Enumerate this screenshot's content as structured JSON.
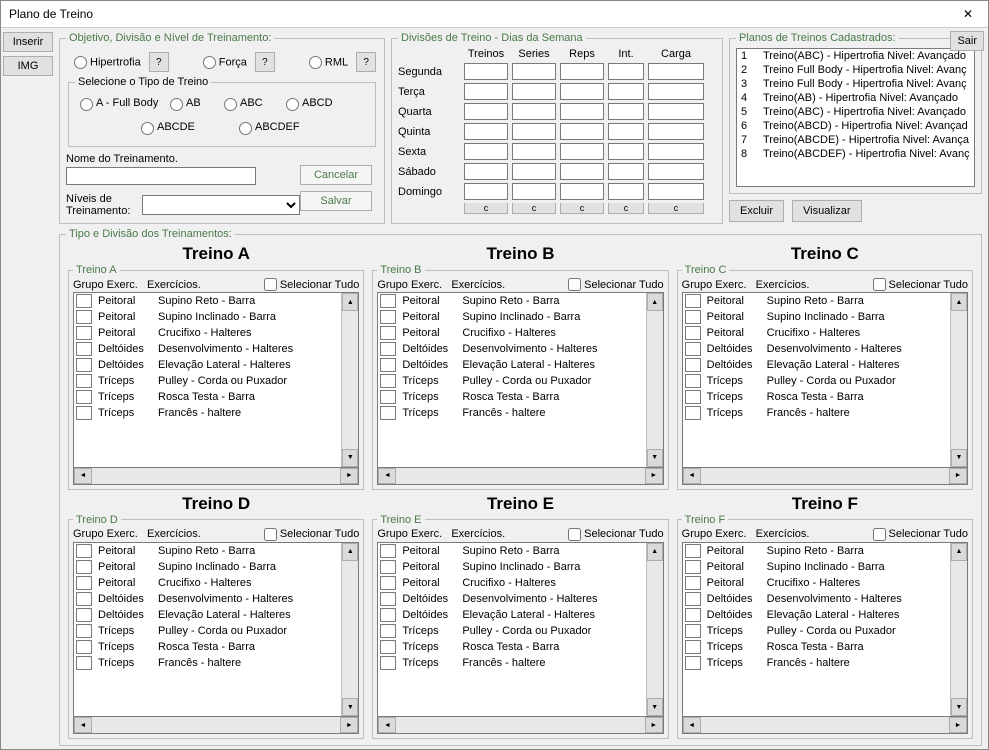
{
  "window_title": "Plano de Treino",
  "btn_inserir": "Inserir",
  "btn_img": "IMG",
  "btn_sair": "Sair",
  "obj": {
    "legend": "Objetivo, Divisão e Nível de Treinamento:",
    "hipertrofia": "Hipertrofia",
    "forca": "Força",
    "rml": "RML",
    "q": "?",
    "tipo_legend": "Selecione o Tipo de Treino",
    "tipo": {
      "a": "A - Full Body",
      "ab": "AB",
      "abc": "ABC",
      "abcd": "ABCD",
      "abcde": "ABCDE",
      "abcdef": "ABCDEF"
    },
    "nome_lbl": "Nome do Treinamento.",
    "nome_val": "",
    "niv_lbl": "Níveis de Treinamento:",
    "cancelar": "Cancelar",
    "salvar": "Salvar"
  },
  "div": {
    "legend": "Divisões de Treino - Dias da Semana",
    "cols": [
      "Treinos",
      "Series",
      "Reps",
      "Int.",
      "Carga"
    ],
    "days": [
      "Segunda",
      "Terça",
      "Quarta",
      "Quinta",
      "Sexta",
      "Sábado",
      "Domingo"
    ],
    "c": "c"
  },
  "planos": {
    "legend": "Planos de Treinos Cadastrados:",
    "items": [
      "Treino(ABC) - Hipertrofia Nivel: Avançado",
      "Treino Full Body - Hipertrofia Nivel: Avanç",
      "Treino Full Body - Hipertrofia Nivel: Avanç",
      "Treino(AB) - Hipertrofia Nivel: Avançado",
      "Treino(ABC) - Hipertrofia Nivel: Avançado",
      "Treino(ABCD) - Hipertrofia Nivel: Avançad",
      "Treino(ABCDE) - Hipertrofia Nivel: Avança",
      "Treino(ABCDEF) - Hipertrofia Nivel: Avanç"
    ],
    "excluir": "Excluir",
    "visualizar": "Visualizar"
  },
  "big": {
    "legend": "Tipo e Divisão dos Treinamentos:",
    "titles": [
      "Treino A",
      "Treino B",
      "Treino C",
      "Treino D",
      "Treino E",
      "Treino F"
    ],
    "fset_legends": [
      "Treino A",
      "Treino B",
      "Treino C",
      "Treino D",
      "Treino E",
      "Treino F"
    ],
    "hdr_g": "Grupo Exerc.",
    "hdr_e": "Exercícios.",
    "sel": "Selecionar Tudo",
    "rows": [
      {
        "g": "Peitoral",
        "e": "Supino Reto - Barra"
      },
      {
        "g": "Peitoral",
        "e": "Supino Inclinado - Barra"
      },
      {
        "g": "Peitoral",
        "e": "Crucifixo - Halteres"
      },
      {
        "g": "Deltóides",
        "e": "Desenvolvimento - Halteres"
      },
      {
        "g": "Deltóides",
        "e": "Elevação Lateral - Halteres"
      },
      {
        "g": "Tríceps",
        "e": "Pulley - Corda ou Puxador"
      },
      {
        "g": "Tríceps",
        "e": "Rosca Testa - Barra"
      },
      {
        "g": "Tríceps",
        "e": "Francês - haltere"
      }
    ]
  }
}
